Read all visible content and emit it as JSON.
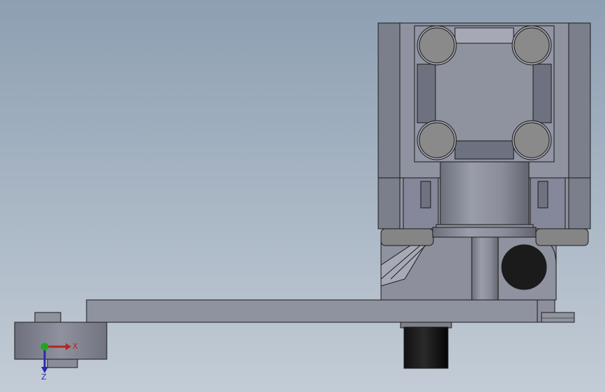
{
  "viewport": {
    "background_top": "#8d9fb2",
    "background_bottom": "#c3ccd6"
  },
  "model": {
    "body_color": "#8f929f",
    "body_dark": "#6e7180",
    "body_light": "#a4a7b3",
    "edge_color": "#1a1a1a",
    "hole_color": "#1b1b1b",
    "boss_color": "#858585"
  },
  "triad": {
    "x_label": "X",
    "z_label": "Z",
    "x_color": "#b52424",
    "y_color": "#1fa61f",
    "z_color": "#2a2aa8"
  }
}
